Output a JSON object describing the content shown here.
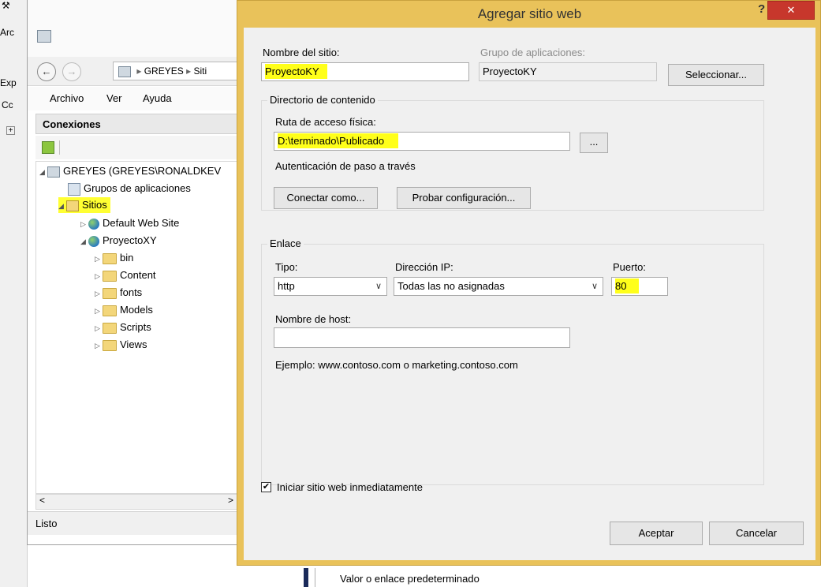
{
  "background": {
    "left_labels": [
      "Arc",
      "Exp",
      "Cc"
    ],
    "bottom_text": "Valor o enlace predeterminado"
  },
  "iis": {
    "breadcrumb": [
      "GREYES",
      "Siti"
    ],
    "menu": [
      "Archivo",
      "Ver",
      "Ayuda"
    ],
    "connections_header": "Conexiones",
    "tree": {
      "server": "GREYES (GREYES\\RONALDKEV",
      "app_pools": "Grupos de aplicaciones",
      "sites": "Sitios",
      "default_site": "Default Web Site",
      "project": "ProyectoXY",
      "folders": [
        "bin",
        "Content",
        "fonts",
        "Models",
        "Scripts",
        "Views"
      ]
    },
    "status": "Listo"
  },
  "dialog": {
    "title": "Agregar sitio web",
    "help": "?",
    "close": "✕",
    "site_name_label": "Nombre del sitio:",
    "site_name_value": "ProyectoKY",
    "app_pool_label": "Grupo de aplicaciones:",
    "app_pool_value": "ProyectoKY",
    "select_button": "Seleccionar...",
    "content_group": "Directorio de contenido",
    "physical_path_label": "Ruta de acceso física:",
    "physical_path_value": "D:\\terminado\\Publicado",
    "browse_button": "...",
    "passthrough_auth": "Autenticación de paso a través",
    "connect_as_button": "Conectar como...",
    "test_settings_button": "Probar configuración...",
    "binding_group": "Enlace",
    "type_label": "Tipo:",
    "type_value": "http",
    "ip_label": "Dirección IP:",
    "ip_value": "Todas las no asignadas",
    "port_label": "Puerto:",
    "port_value": "80",
    "host_label": "Nombre de host:",
    "host_value": "",
    "example_text": "Ejemplo: www.contoso.com o marketing.contoso.com",
    "start_immediately_label": "Iniciar sitio web inmediatamente",
    "start_immediately_checked": true,
    "ok_button": "Aceptar",
    "cancel_button": "Cancelar"
  },
  "colors": {
    "highlight": "#ffff1a",
    "dialog_frame": "#e9c25a",
    "close_red": "#c7372c"
  }
}
